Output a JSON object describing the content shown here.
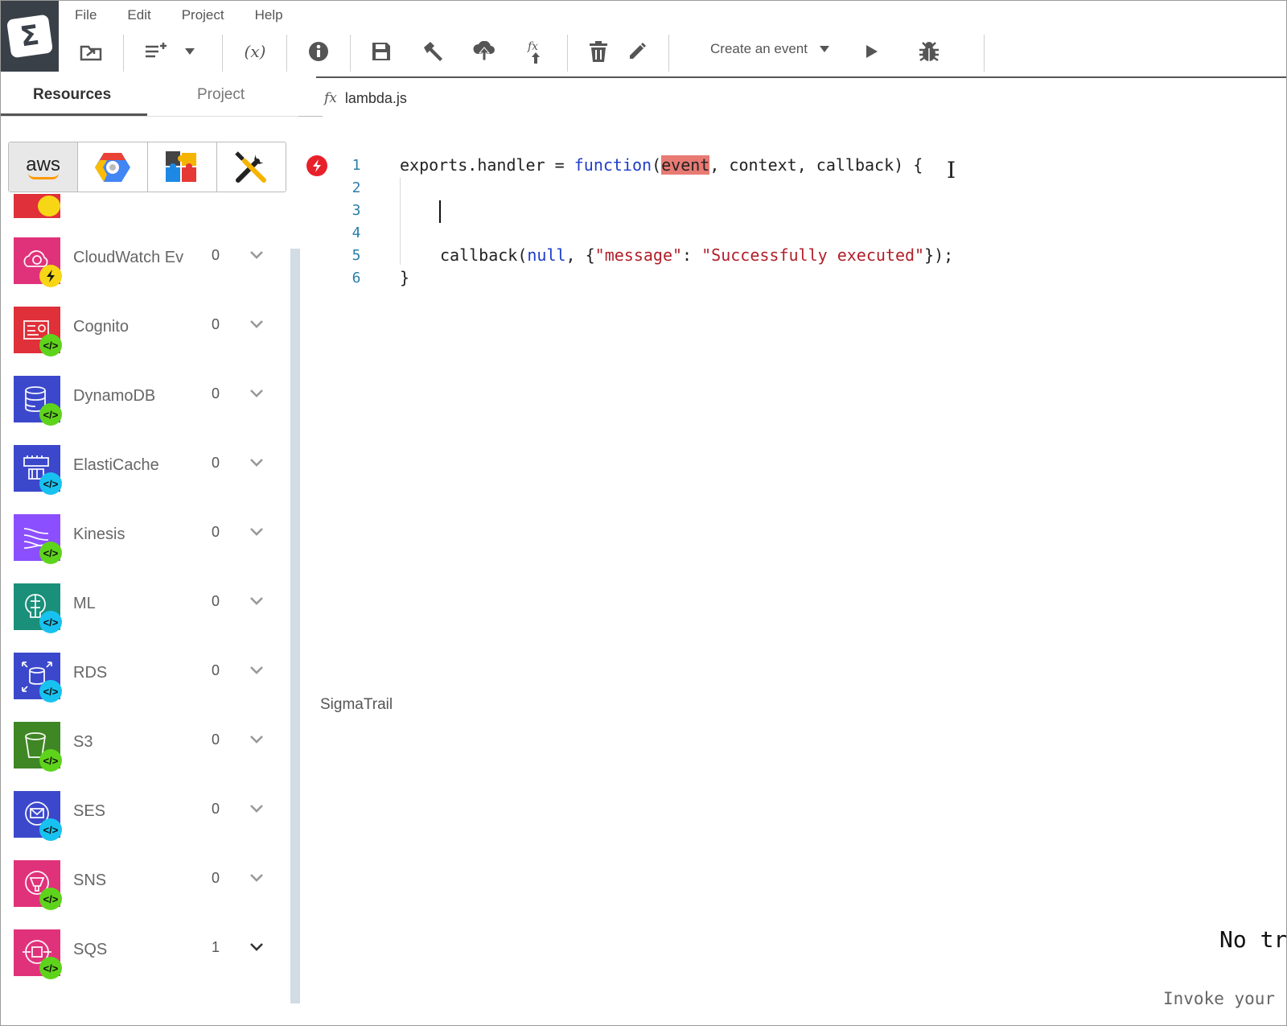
{
  "menu": {
    "file": "File",
    "edit": "Edit",
    "project": "Project",
    "help": "Help"
  },
  "toolbar": {
    "variables": "(x)",
    "event_select": "Create an event"
  },
  "left_tabs": {
    "resources": "Resources",
    "project": "Project"
  },
  "providers": {
    "aws": "aws"
  },
  "resources": [
    {
      "label": "CloudWatch Ev",
      "count": "0",
      "color": "#e0327a",
      "badge": "yellow"
    },
    {
      "label": "Cognito",
      "count": "0",
      "color": "#e0303a",
      "badge": "green"
    },
    {
      "label": "DynamoDB",
      "count": "0",
      "color": "#3b48cc",
      "badge": "green"
    },
    {
      "label": "ElastiCache",
      "count": "0",
      "color": "#3b48cc",
      "badge": "cyan"
    },
    {
      "label": "Kinesis",
      "count": "0",
      "color": "#8c4fff",
      "badge": "green"
    },
    {
      "label": "ML",
      "count": "0",
      "color": "#1a8f7a",
      "badge": "cyan"
    },
    {
      "label": "RDS",
      "count": "0",
      "color": "#3b48cc",
      "badge": "cyan"
    },
    {
      "label": "S3",
      "count": "0",
      "color": "#3f8624",
      "badge": "green"
    },
    {
      "label": "SES",
      "count": "0",
      "color": "#3b48cc",
      "badge": "cyan"
    },
    {
      "label": "SNS",
      "count": "0",
      "color": "#e0327a",
      "badge": "green"
    },
    {
      "label": "SQS",
      "count": "1",
      "color": "#e0327a",
      "badge": "green"
    }
  ],
  "editor": {
    "tab_icon": "fx",
    "tab_label": "lambda.js",
    "line_numbers": [
      "1",
      "2",
      "3",
      "4",
      "5",
      "6"
    ],
    "line1": {
      "a": "exports.handler = ",
      "kw": "function",
      "p": "(",
      "hl": "event",
      "b": ", context, callback) {"
    },
    "line5": {
      "a": "callback(",
      "kw": "null",
      "b": ", {",
      "s1": "\"message\"",
      "c": ": ",
      "s2": "\"Successfully executed\"",
      "d": "});"
    },
    "line6": "}"
  },
  "panel": {
    "sigma_label": "SigmaTrail",
    "no_trace": "No tr",
    "invoke_hint": "Invoke your"
  },
  "colors": {
    "logo_bg": "#3a4047",
    "keyword": "#1f3cc8",
    "string": "#b0202a",
    "highlight": "#e87a74",
    "line_numbers": "#2a7fa8",
    "error": "#e8202a",
    "scrollbar": "#d2dce4"
  }
}
